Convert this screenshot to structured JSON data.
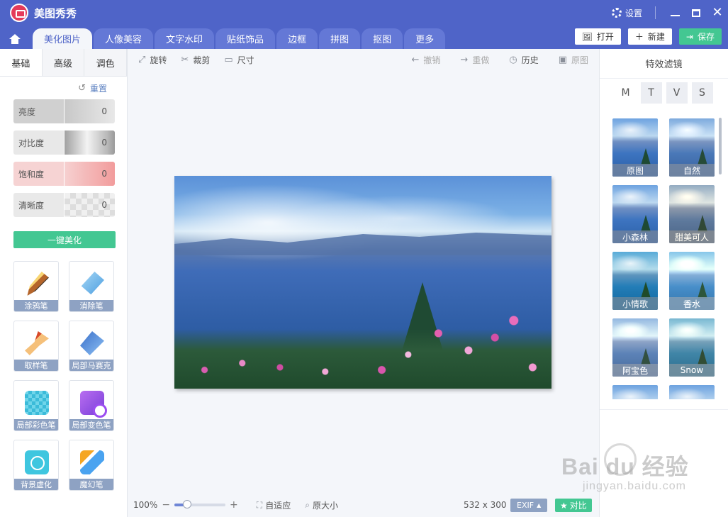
{
  "app": {
    "title": "美图秀秀",
    "settings_label": "设置"
  },
  "nav": {
    "tabs": [
      "美化图片",
      "人像美容",
      "文字水印",
      "贴纸饰品",
      "边框",
      "拼图",
      "抠图",
      "更多"
    ],
    "active_tab": "美化图片",
    "actions": {
      "open": "打开",
      "new": "新建",
      "save": "保存"
    }
  },
  "left_panel": {
    "subtabs": [
      "基础",
      "高级",
      "调色"
    ],
    "active_subtab": "基础",
    "reset_label": "重置",
    "sliders": [
      {
        "label": "亮度",
        "value": "0"
      },
      {
        "label": "对比度",
        "value": "0"
      },
      {
        "label": "饱和度",
        "value": "0"
      },
      {
        "label": "清晰度",
        "value": "0"
      }
    ],
    "one_click_label": "一键美化",
    "tools": [
      "涂鸦笔",
      "消除笔",
      "取样笔",
      "局部马赛克",
      "局部彩色笔",
      "局部变色笔",
      "背景虚化",
      "魔幻笔"
    ]
  },
  "toolbar": {
    "left": [
      "旋转",
      "裁剪",
      "尺寸"
    ],
    "right": [
      "撤销",
      "重做",
      "历史",
      "原图"
    ]
  },
  "bottom_bar": {
    "zoom_label": "100%",
    "zoom_level": 0.25,
    "fit_label": "自适应",
    "original_size_label": "原大小",
    "image_size": "532 x 300",
    "exif_label": "EXIF",
    "compare_label": "对比"
  },
  "right_panel": {
    "title": "特效滤镜",
    "categories": [
      "M",
      "T",
      "V",
      "S"
    ],
    "filters": [
      "原图",
      "自然",
      "小森林",
      "甜美可人",
      "小情歌",
      "香水",
      "阿宝色",
      "Snow"
    ]
  },
  "watermark": {
    "main": "Bai du 经验",
    "sub": "jingyan.baidu.com"
  },
  "colors": {
    "primary": "#4f64c8",
    "accent_green": "#43c792",
    "tool_label": "#8ea2c3"
  }
}
